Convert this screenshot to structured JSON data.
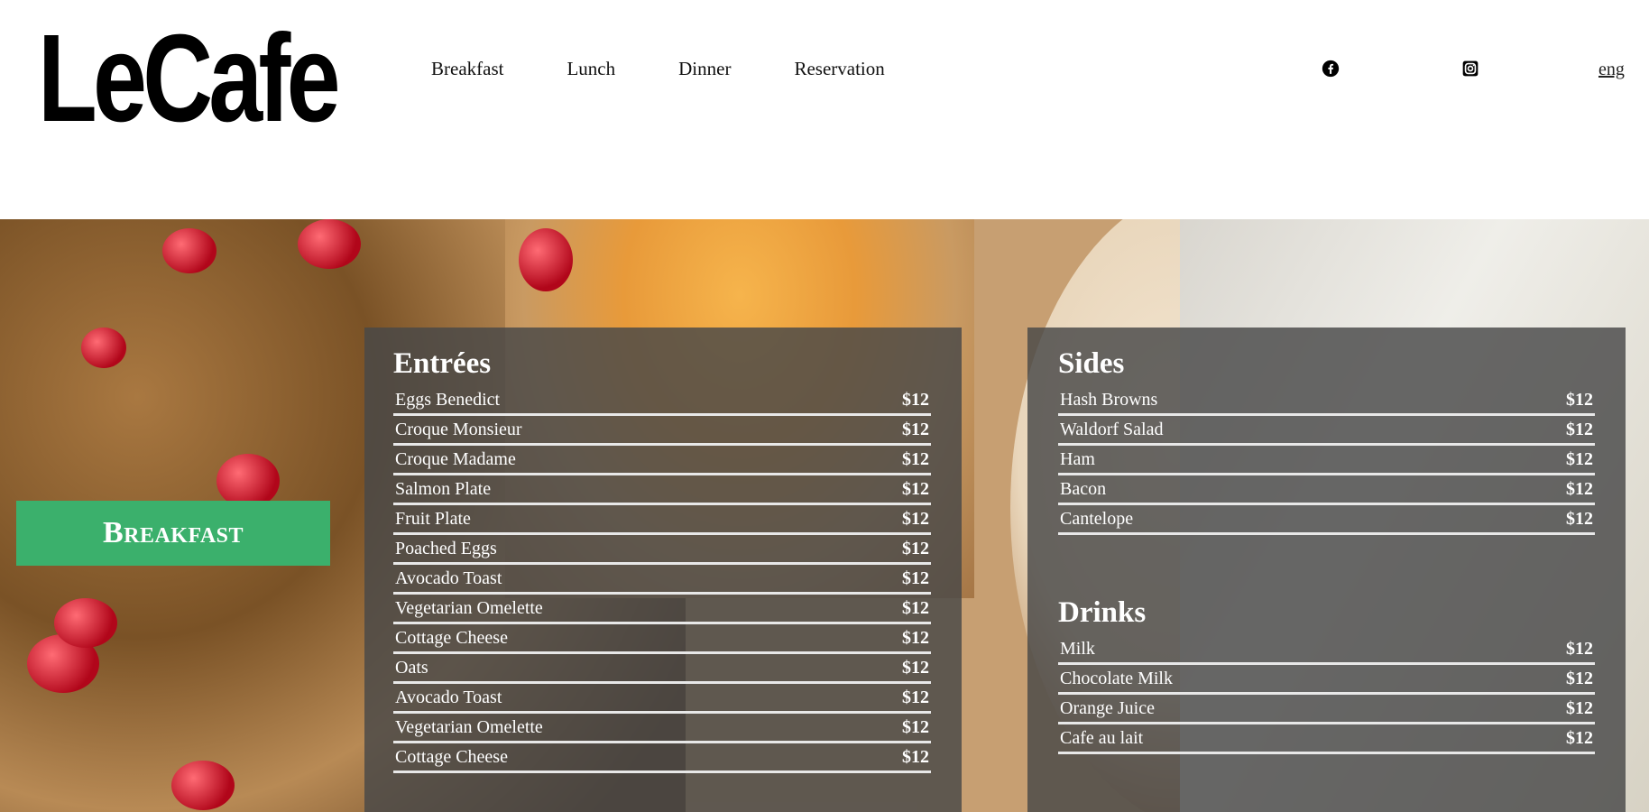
{
  "logo": "LeCafe",
  "nav": [
    "Breakfast",
    "Lunch",
    "Dinner",
    "Reservation"
  ],
  "social_icons": [
    "facebook-icon",
    "instagram-icon"
  ],
  "lang": "eng",
  "banner": "Breakfast",
  "entrees": {
    "title": "Entrées",
    "items": [
      {
        "name": "Eggs Benedict",
        "price": "$12"
      },
      {
        "name": "Croque Monsieur",
        "price": "$12"
      },
      {
        "name": "Croque Madame",
        "price": "$12"
      },
      {
        "name": "Salmon Plate",
        "price": "$12"
      },
      {
        "name": "Fruit Plate",
        "price": "$12"
      },
      {
        "name": "Poached Eggs",
        "price": "$12"
      },
      {
        "name": "Avocado Toast",
        "price": "$12"
      },
      {
        "name": "Vegetarian Omelette",
        "price": "$12"
      },
      {
        "name": "Cottage Cheese",
        "price": "$12"
      },
      {
        "name": "Oats",
        "price": "$12"
      },
      {
        "name": "Avocado Toast",
        "price": "$12"
      },
      {
        "name": "Vegetarian Omelette",
        "price": "$12"
      },
      {
        "name": "Cottage Cheese",
        "price": "$12"
      }
    ]
  },
  "sides": {
    "title": "Sides",
    "items": [
      {
        "name": "Hash Browns",
        "price": "$12"
      },
      {
        "name": "Waldorf Salad",
        "price": "$12"
      },
      {
        "name": "Ham",
        "price": "$12"
      },
      {
        "name": "Bacon",
        "price": "$12"
      },
      {
        "name": "Cantelope",
        "price": "$12"
      }
    ]
  },
  "drinks": {
    "title": "Drinks",
    "items": [
      {
        "name": "Milk",
        "price": "$12"
      },
      {
        "name": "Chocolate Milk",
        "price": "$12"
      },
      {
        "name": "Orange Juice",
        "price": "$12"
      },
      {
        "name": "Cafe au lait",
        "price": "$12"
      }
    ]
  }
}
